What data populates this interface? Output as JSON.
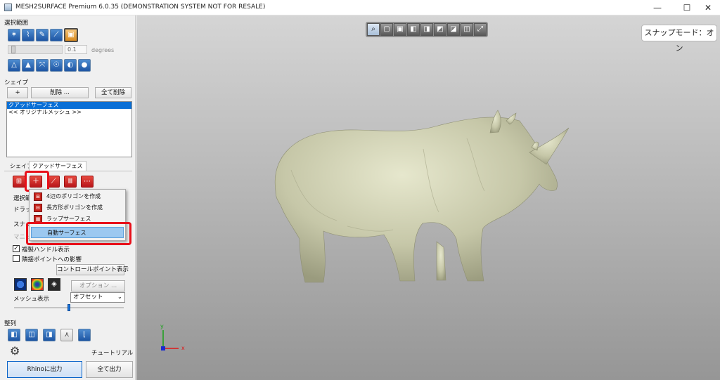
{
  "window": {
    "title": "MESH2SURFACE Premium 6.0.35 (DEMONSTRATION SYSTEM NOT FOR RESALE)",
    "minimize": "—",
    "maximize": "☐",
    "close": "✕"
  },
  "selection": {
    "section_label": "選択範囲",
    "tools_row1": [
      "select-icon",
      "lasso-icon",
      "brush-icon",
      "edge-icon",
      "region-icon"
    ],
    "slider_value": "0.1",
    "slider_unit": "degrees",
    "tools_row2": [
      "triangle-outline-icon",
      "triangle-fill-icon",
      "grow-icon",
      "bulb-outline-icon",
      "bulb-half-icon",
      "bulb-fill-icon"
    ]
  },
  "shape": {
    "section_label": "シェイプ",
    "add_label": "+",
    "delete_label": "削除 ...",
    "delete_all_label": "全て削除",
    "list_items": [
      {
        "label": "クアッドサーフェス",
        "selected": true
      },
      {
        "label": "<< オリジナルメッシュ >>",
        "selected": false
      }
    ]
  },
  "tabs": [
    {
      "label": "シェイプ",
      "active": false
    },
    {
      "label": "クアッドサーフェス",
      "active": true
    }
  ],
  "quad_tools": [
    "quad-mesh-icon",
    "quad-add-icon",
    "quad-diag-icon",
    "quad-columns-icon",
    "quad-dots-icon"
  ],
  "quad_panel": {
    "selection_label": "選択範",
    "drag_label": "ドラッグ",
    "snap_label": "スナッ",
    "manual_label": "マニュ",
    "show_dup_handles_label": "複製ハンドル表示",
    "show_dup_handles_checked": true,
    "adjacent_effect_label": "隣接ポイントへの影響",
    "adjacent_effect_checked": false,
    "control_points_label": "コントロールポイント表示",
    "options_label": "オプション ...",
    "mesh_display_label": "メッシュ表示",
    "mesh_display_value": "オフセット",
    "mesh_display_level": 0.5
  },
  "dropdown": {
    "items": [
      {
        "label": "4辺のポリゴンを作成",
        "icon": "polygon-4-icon"
      },
      {
        "label": "長方形ポリゴンを作成",
        "icon": "polygon-rect-icon"
      },
      {
        "label": "ラップサーフェス",
        "icon": "wrap-icon"
      },
      {
        "label": "自動サーフェス",
        "icon": "",
        "hover": true
      }
    ]
  },
  "align": {
    "section_label": "整列",
    "tools": [
      "align-left-icon",
      "align-center-icon",
      "align-right-icon",
      "align-split-icon",
      "align-corner-icon"
    ]
  },
  "footer": {
    "tutorial_label": "チュートリアル",
    "rhino_export_label": "Rhinoに出力",
    "export_all_label": "全て出力"
  },
  "viewport": {
    "view_buttons": [
      "zoom-icon",
      "front-view-icon",
      "back-view-icon",
      "left-view-icon",
      "right-view-icon",
      "top-view-icon",
      "bottom-view-icon",
      "iso-view-icon",
      "fit-view-icon"
    ],
    "snap_mode_label": "スナップモード：オン",
    "axis_y": "y",
    "axis_x": "x",
    "model_color": "#c6c7a8"
  },
  "colors": {
    "selection_blue": "#0a6fd6",
    "highlight_red": "#e8101a",
    "tool_red": "#c8241c"
  }
}
